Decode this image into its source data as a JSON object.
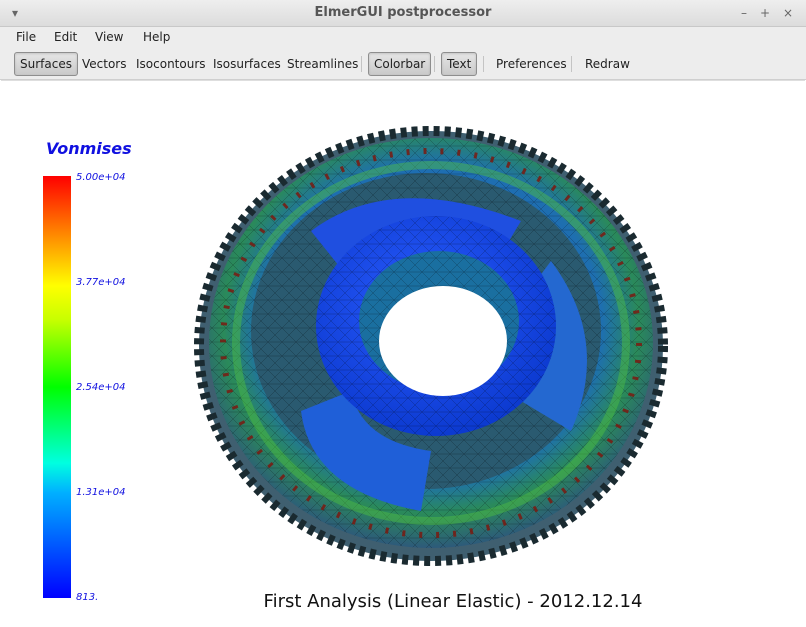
{
  "window": {
    "title": "ElmerGUI postprocessor"
  },
  "menu": {
    "items": [
      "File",
      "Edit",
      "View",
      "Help"
    ]
  },
  "toolbar": {
    "surfaces": "Surfaces",
    "vectors": "Vectors",
    "isocontours": "Isocontours",
    "isosurfaces": "Isosurfaces",
    "streamlines": "Streamlines",
    "colorbar": "Colorbar",
    "text": "Text",
    "preferences": "Preferences",
    "redraw": "Redraw"
  },
  "legend": {
    "title": "Vonmises",
    "labels": [
      "5.00e+04",
      "3.77e+04",
      "2.54e+04",
      "1.31e+04",
      "813."
    ]
  },
  "caption": "First Analysis (Linear Elastic) - 2012.12.14",
  "colors": {
    "legend_text": "#1010e0",
    "active_toolbutton": "#c9c9c9"
  }
}
